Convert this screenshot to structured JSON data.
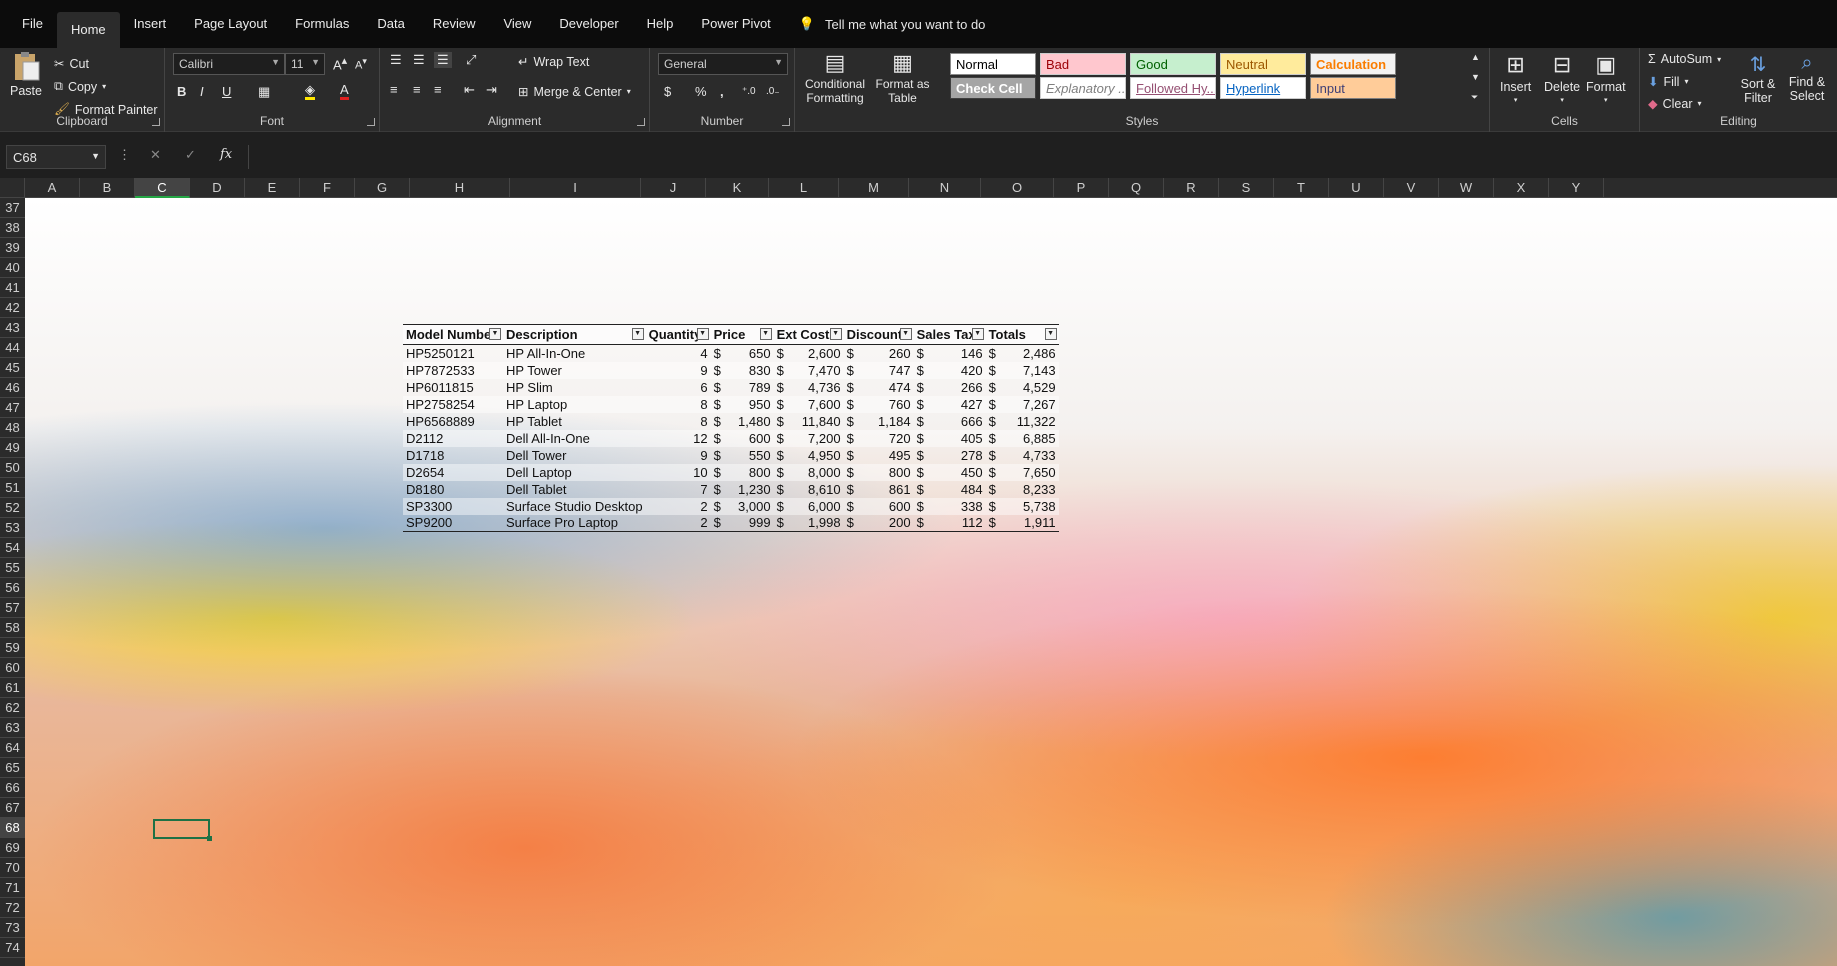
{
  "tabs": [
    "File",
    "Home",
    "Insert",
    "Page Layout",
    "Formulas",
    "Data",
    "Review",
    "View",
    "Developer",
    "Help",
    "Power Pivot"
  ],
  "active_tab": "Home",
  "tell_me": "Tell me what you want to do",
  "clipboard": {
    "paste": "Paste",
    "cut": "Cut",
    "copy": "Copy",
    "format_painter": "Format Painter",
    "label": "Clipboard"
  },
  "font": {
    "name": "Calibri",
    "size": "11",
    "label": "Font",
    "bold": "B",
    "italic": "I",
    "underline": "U"
  },
  "alignment": {
    "wrap": "Wrap Text",
    "merge": "Merge & Center",
    "label": "Alignment"
  },
  "number": {
    "format": "General",
    "dollar": "$",
    "percent": "%",
    "comma": ",",
    "label": "Number"
  },
  "styles": {
    "conditional": "Conditional Formatting",
    "format_table": "Format as Table",
    "cells": [
      "Normal",
      "Bad",
      "Good",
      "Neutral",
      "Calculation",
      "Check Cell",
      "Explanatory ...",
      "Followed Hy...",
      "Hyperlink",
      "Input"
    ],
    "label": "Styles"
  },
  "cells": {
    "insert": "Insert",
    "delete": "Delete",
    "format": "Format",
    "label": "Cells"
  },
  "editing": {
    "autosum": "AutoSum",
    "fill": "Fill",
    "clear": "Clear",
    "sort": "Sort & Filter",
    "find": "Find & Select",
    "label": "Editing"
  },
  "namebox": "C68",
  "fx": "fx",
  "columns": [
    "A",
    "B",
    "C",
    "D",
    "E",
    "F",
    "G",
    "H",
    "I",
    "J",
    "K",
    "L",
    "M",
    "N",
    "O",
    "P",
    "Q",
    "R",
    "S",
    "T",
    "U",
    "V",
    "W",
    "X",
    "Y"
  ],
  "rows": [
    "37",
    "38",
    "39",
    "40",
    "41",
    "42",
    "43",
    "44",
    "45",
    "46",
    "47",
    "48",
    "49",
    "50",
    "51",
    "52",
    "53",
    "54",
    "55",
    "56",
    "57",
    "58",
    "59",
    "60",
    "61",
    "62",
    "63",
    "64",
    "65",
    "66",
    "67",
    "68",
    "69",
    "70",
    "71",
    "72",
    "73",
    "74"
  ],
  "table": {
    "headers": [
      "Model Number",
      "Description",
      "Quantity",
      "Price",
      "Ext Cost",
      "Discounts",
      "Sales Tax",
      "Totals"
    ],
    "rows": [
      [
        "HP5250121",
        "HP All-In-One",
        "4",
        "650",
        "2,600",
        "260",
        "146",
        "2,486"
      ],
      [
        "HP7872533",
        "HP Tower",
        "9",
        "830",
        "7,470",
        "747",
        "420",
        "7,143"
      ],
      [
        "HP6011815",
        "HP Slim",
        "6",
        "789",
        "4,736",
        "474",
        "266",
        "4,529"
      ],
      [
        "HP2758254",
        "HP Laptop",
        "8",
        "950",
        "7,600",
        "760",
        "427",
        "7,267"
      ],
      [
        "HP6568889",
        "HP Tablet",
        "8",
        "1,480",
        "11,840",
        "1,184",
        "666",
        "11,322"
      ],
      [
        "D2112",
        "Dell All-In-One",
        "12",
        "600",
        "7,200",
        "720",
        "405",
        "6,885"
      ],
      [
        "D1718",
        "Dell Tower",
        "9",
        "550",
        "4,950",
        "495",
        "278",
        "4,733"
      ],
      [
        "D2654",
        "Dell Laptop",
        "10",
        "800",
        "8,000",
        "800",
        "450",
        "7,650"
      ],
      [
        "D8180",
        "Dell Tablet",
        "7",
        "1,230",
        "8,610",
        "861",
        "484",
        "8,233"
      ],
      [
        "SP3300",
        "Surface Studio Desktop",
        "2",
        "3,000",
        "6,000",
        "600",
        "338",
        "5,738"
      ],
      [
        "SP9200",
        "Surface Pro Laptop",
        "2",
        "999",
        "1,998",
        "200",
        "112",
        "1,911"
      ]
    ],
    "currency": "$"
  }
}
